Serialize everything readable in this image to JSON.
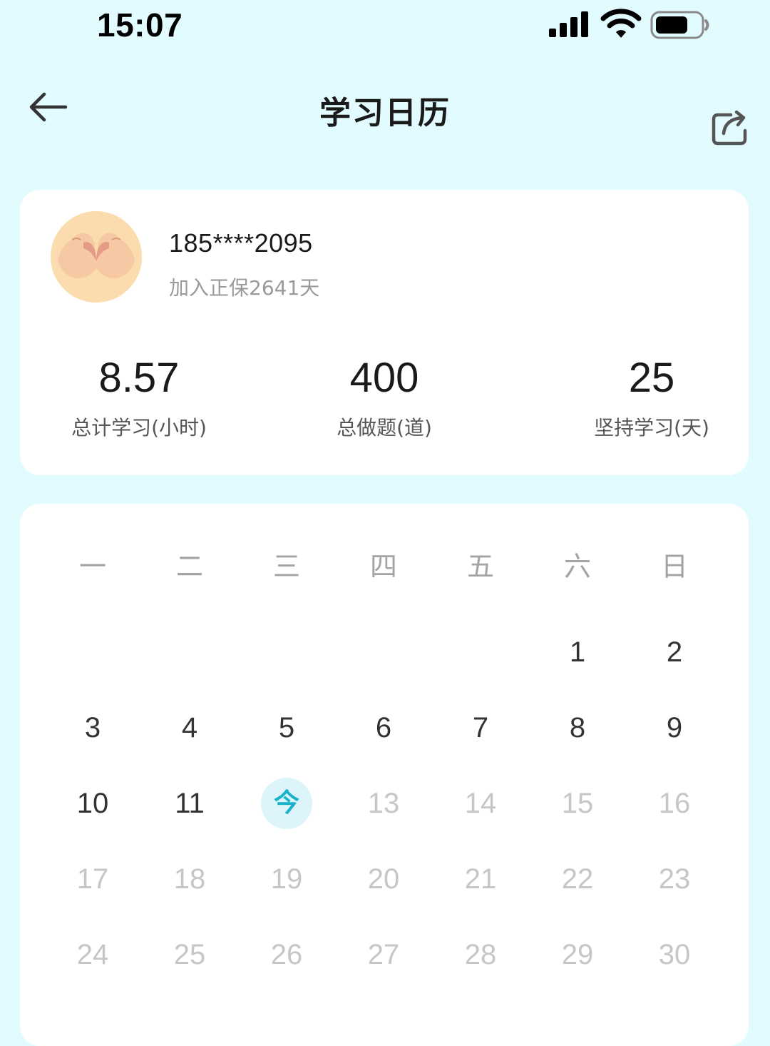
{
  "status_bar": {
    "time": "15:07"
  },
  "nav": {
    "title": "学习日历"
  },
  "profile": {
    "user_name": "185****2095",
    "join_days": "加入正保2641天"
  },
  "stats": [
    {
      "value": "8.57",
      "label": "总计学习(小时)"
    },
    {
      "value": "400",
      "label": "总做题(道)"
    },
    {
      "value": "25",
      "label": "坚持学习(天)"
    }
  ],
  "calendar": {
    "weekdays": [
      "一",
      "二",
      "三",
      "四",
      "五",
      "六",
      "日"
    ],
    "today_label": "今",
    "weeks": [
      [
        "",
        "",
        "",
        "",
        "",
        "1",
        "2"
      ],
      [
        "3",
        "4",
        "5",
        "6",
        "7",
        "8",
        "9"
      ],
      [
        "10",
        "11",
        "今",
        "13",
        "14",
        "15",
        "16"
      ],
      [
        "17",
        "18",
        "19",
        "20",
        "21",
        "22",
        "23"
      ],
      [
        "24",
        "25",
        "26",
        "27",
        "28",
        "29",
        "30"
      ]
    ]
  },
  "colors": {
    "background": "#e2fbfe",
    "card": "#ffffff",
    "accent": "#19b3c9",
    "today_bg": "#dcf4fa",
    "past_day": "#333333",
    "future_day": "#c6c6c6",
    "weekday": "#a3a3a3",
    "subtext": "#9a9a9a"
  },
  "icons": {
    "back": "arrow-left-icon",
    "share": "share-icon",
    "signal": "cellular-signal-icon",
    "wifi": "wifi-icon",
    "battery": "battery-icon"
  }
}
